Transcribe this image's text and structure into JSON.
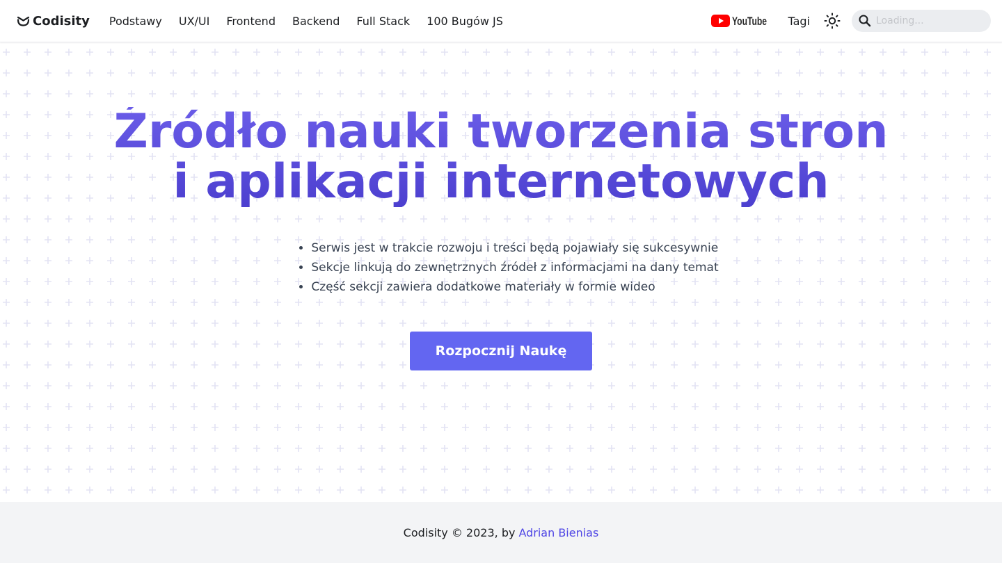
{
  "navbar": {
    "brand": "Codisity",
    "links": [
      "Podstawy",
      "UX/UI",
      "Frontend",
      "Backend",
      "Full Stack",
      "100 Bugów JS"
    ],
    "youtube_label": "YouTube",
    "tags_label": "Tagi",
    "search_placeholder": "Loading..."
  },
  "hero": {
    "title_line1": "Źródło nauki tworzenia stron",
    "title_line2": "i aplikacji internetowych",
    "bullets": [
      "Serwis jest w trakcie rozwoju i treści będą pojawiały się sukcesywnie",
      "Sekcje linkują do zewnętrznych źródeł z informacjami na dany temat",
      "Część sekcji zawiera dodatkowe materiały w formie wideo"
    ],
    "cta_label": "Rozpocznij Naukę"
  },
  "footer": {
    "text": "Codisity © 2023, by",
    "author": "Adrian Bienias"
  },
  "colors": {
    "accent": "#6366f1",
    "title": "#5b4fdb",
    "link": "#4f46e5",
    "youtube_red": "#ff0000",
    "pattern": "#e3e3f4"
  },
  "icons": {
    "brand": "codisity-logo-icon",
    "youtube": "youtube-icon",
    "theme": "sun-icon",
    "search": "search-icon"
  }
}
